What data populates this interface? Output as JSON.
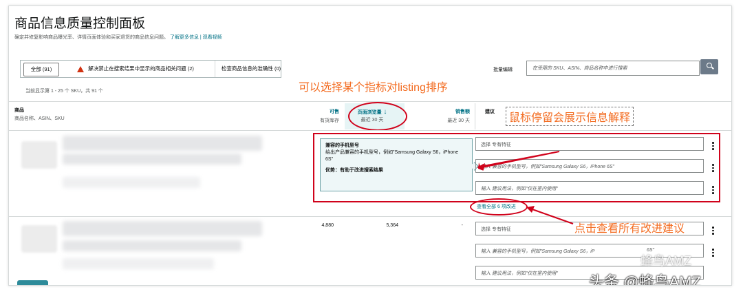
{
  "page": {
    "title": "商品信息质量控制面板",
    "subtitle": "确定并修复影响商品曝光率、详情页面体验和买家退货的商品信息问题。",
    "learn_more": "了解更多信息",
    "video_sep": " | ",
    "watch_video": "观看视频"
  },
  "tabs": {
    "all": "全部 (91)",
    "suppress": "解决禁止在搜索结果中显示的商品相关问题 (2)",
    "check": "检查商品信息的准确性 (0)"
  },
  "bulk_edit": "批量编辑",
  "search": {
    "placeholder": "在受限的 SKU、ASIN、商品名称中进行搜索"
  },
  "showing": "当前显示第 1 - 25 个 SKU，共 91 个",
  "annotations": {
    "sort": "可以选择某个指标对listing排序",
    "hover": "鼠标停留会展示信息解释",
    "click": "点击查看所有改进建议"
  },
  "columns": {
    "product": "商品",
    "product_sub": "商品名称、ASIN、SKU",
    "available": "可售",
    "available_sub": "有货库存",
    "page_views": "页面浏览量",
    "page_views_sub": "最近 30 天",
    "sales": "销售额",
    "sales_sub": "最近 30 天",
    "suggestions": "建议"
  },
  "tooltip": {
    "title": "兼容的手机型号",
    "body": "给出产品兼容的手机型号，例如\"Samsung Galaxy S6，iPhone 6S\"",
    "benefit": "优势：有助于改进搜索结果"
  },
  "rows": [
    {
      "available": "",
      "page_views": "",
      "sales": "",
      "field1": "选择 专有特征",
      "field2": "输入 兼容的手机型号，例如\"Samsung Galaxy S6，iPhone 6S\"",
      "field3": "输入 建议用法，例如\"仅在室内使用\"",
      "view_all": "查看全部 6 项改进"
    },
    {
      "available": "4,880",
      "page_views": "5,364",
      "sales": "-",
      "field1": "选择 专有特征",
      "field2": "输入 兼容的手机型号，例如\"Samsung Galaxy S6，iP",
      "field2b": "6S\"",
      "field3": "输入 建议用法，例如\"仅在室内使用\""
    }
  ],
  "watermark": "头条 @蜂鸟AMZ",
  "watermark2": "蜂鸟AMZ",
  "colors": {
    "annotation": "#f36c21",
    "highlight": "#d0021b",
    "link": "#007185"
  }
}
